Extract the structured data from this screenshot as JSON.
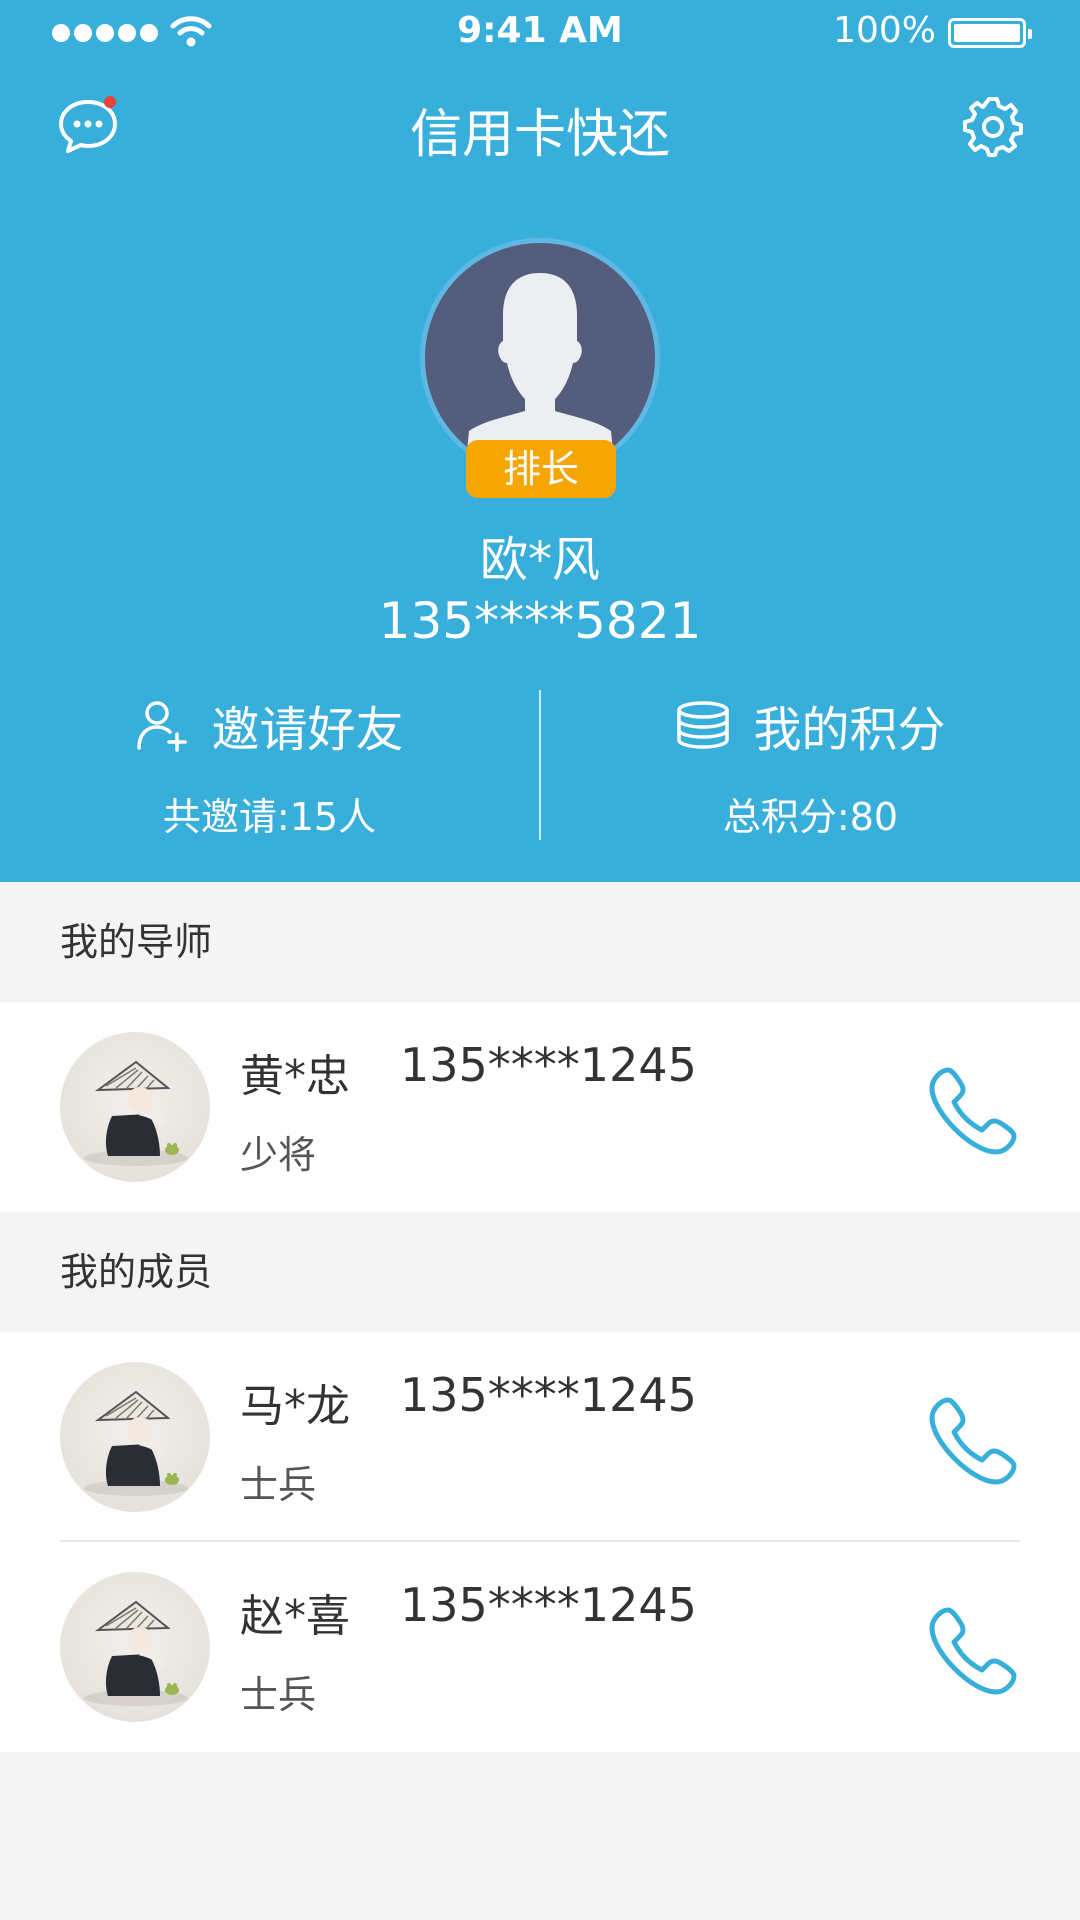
{
  "status_bar": {
    "time": "9:41 AM",
    "battery": "100%"
  },
  "nav": {
    "title": "信用卡快还"
  },
  "profile": {
    "badge": "排长",
    "name": "欧*风",
    "phone": "135****5821"
  },
  "stats": {
    "invite": {
      "label": "邀请好友",
      "value": "共邀请:15人"
    },
    "points": {
      "label": "我的积分",
      "value": "总积分:80"
    }
  },
  "mentor_section": {
    "title": "我的导师",
    "items": [
      {
        "name": "黄*忠",
        "phone": "135****1245",
        "rank": "少将"
      }
    ]
  },
  "members_section": {
    "title": "我的成员",
    "items": [
      {
        "name": "马*龙",
        "phone": "135****1245",
        "rank": "士兵"
      },
      {
        "name": "赵*喜",
        "phone": "135****1245",
        "rank": "士兵"
      }
    ]
  },
  "colors": {
    "primary": "#38aedb",
    "badge": "#f6a603",
    "notification_dot": "#e8403a",
    "background": "#f4f4f4"
  },
  "icons": {
    "message": "chat-bubble-icon",
    "settings": "gear-icon",
    "invite": "add-user-icon",
    "points": "coin-stack-icon",
    "call": "phone-icon"
  }
}
